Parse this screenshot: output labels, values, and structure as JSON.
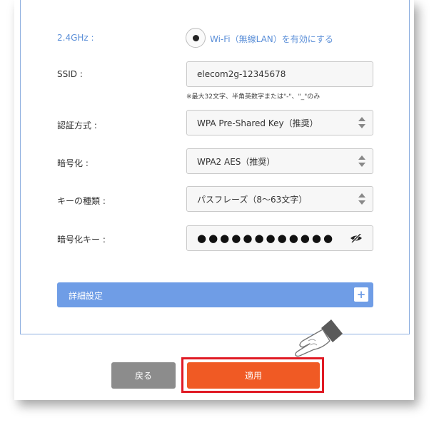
{
  "wifi": {
    "band_label": "2.4GHz :",
    "enable_label": "Wi-Fi（無線LAN）を有効にする",
    "enabled": true
  },
  "form": {
    "ssid_label": "SSID :",
    "ssid_value": "elecom2g-12345678",
    "ssid_hint": "※最大32文字、半角英数字または\"-\"、\"_\"のみ",
    "auth_label": "認証方式 :",
    "auth_value": "WPA Pre-Shared Key（推奨）",
    "enc_label": "暗号化 :",
    "enc_value": "WPA2 AES（推奨）",
    "keytype_label": "キーの種類 :",
    "keytype_value": "パスフレーズ（8～63文字）",
    "key_label": "暗号化キー :",
    "key_value": "●●●●●●●●●●●●"
  },
  "advanced": {
    "label": "詳細設定",
    "toggle": "+"
  },
  "buttons": {
    "back": "戻る",
    "apply": "適用"
  },
  "colors": {
    "accent_blue": "#6f9de6",
    "apply_orange": "#f05a24",
    "highlight_red": "#e01a24",
    "back_gray": "#8c8c8c"
  }
}
